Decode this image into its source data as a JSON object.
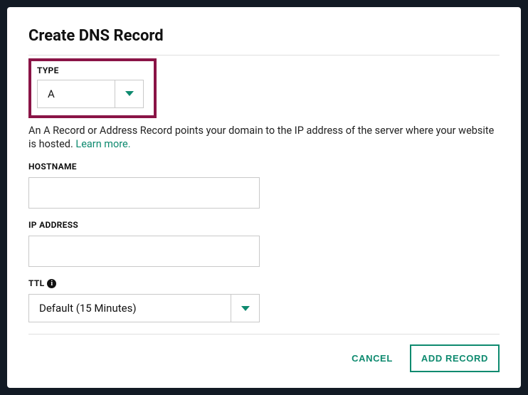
{
  "title": "Create DNS Record",
  "type_field": {
    "label": "TYPE",
    "value": "A",
    "helper": "An A Record or Address Record points your domain to the IP address of the server where your website is hosted. ",
    "learn_more": "Learn more."
  },
  "hostname_field": {
    "label": "HOSTNAME",
    "value": ""
  },
  "ip_field": {
    "label": "IP ADDRESS",
    "value": ""
  },
  "ttl_field": {
    "label": "TTL",
    "value": "Default (15 Minutes)"
  },
  "footer": {
    "cancel": "CANCEL",
    "add": "ADD RECORD"
  }
}
